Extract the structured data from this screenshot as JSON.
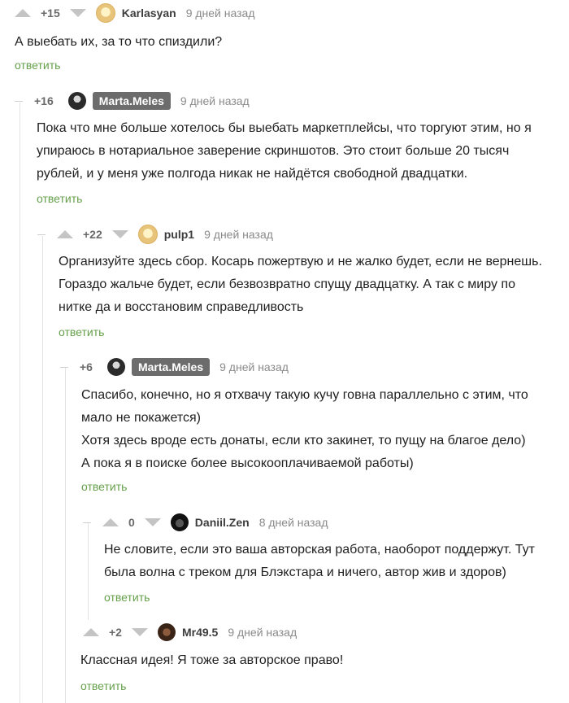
{
  "comments": [
    {
      "rating": "+15",
      "author": "Karlasyan",
      "time": "9 дней назад",
      "lines": [
        "А выебать их, за то что спиздили?"
      ],
      "reply": "ответить"
    },
    {
      "rating": "+16",
      "author": "Marta.Meles",
      "time": "9 дней назад",
      "lines": [
        "Пока что мне больше хотелось бы выебать маркетплейсы, что торгуют этим, но я",
        "упираюсь в нотариальное заверение скриншотов. Это стоит больше 20 тысяч",
        "рублей, и у меня уже полгода никак не найдётся свободной двадцатки."
      ],
      "reply": "ответить"
    },
    {
      "rating": "+22",
      "author": "pulp1",
      "time": "9 дней назад",
      "lines": [
        "Организуйте здесь сбор. Косарь пожертвую и не жалко будет, если не вернешь.",
        "Гораздо жальче будет, если безвозвратно спущу двадцатку. А так с миру по",
        "нитке да и восстановим справедливость"
      ],
      "reply": "ответить"
    },
    {
      "rating": "+6",
      "author": "Marta.Meles",
      "time": "9 дней назад",
      "lines": [
        "Спасибо, конечно, но я отхвачу такую кучу говна параллельно с этим, что",
        "мало не покажется)",
        "Хотя здесь вроде есть донаты, если кто закинет, то пущу на благое дело)",
        "А пока я в поиске более высокооплачиваемой работы)"
      ],
      "reply": "ответить"
    },
    {
      "rating": "0",
      "author": "Daniil.Zen",
      "time": "8 дней назад",
      "lines": [
        "Не словите, если это ваша авторская работа, наоборот поддержут. Тут",
        "была волна с треком для Блэкстара и ничего, автор жив и здоров)"
      ],
      "reply": "ответить"
    },
    {
      "rating": "+2",
      "author": "Mr49.5",
      "time": "9 дней назад",
      "lines": [
        "Классная идея! Я тоже за авторское право!"
      ],
      "reply": "ответить"
    }
  ]
}
